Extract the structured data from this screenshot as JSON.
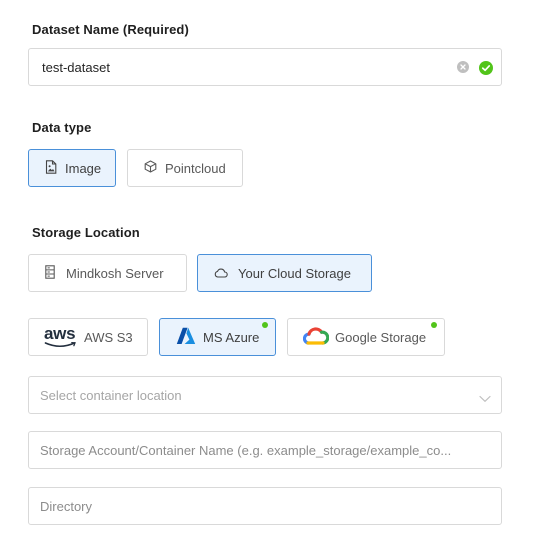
{
  "dataset_name": {
    "label": "Dataset Name (Required)",
    "value": "test-dataset",
    "icons": [
      "clear-icon",
      "valid-check-icon"
    ]
  },
  "data_type": {
    "label": "Data type",
    "options": [
      {
        "label": "Image",
        "icon": "image-file-icon",
        "selected": true
      },
      {
        "label": "Pointcloud",
        "icon": "cube-icon",
        "selected": false
      }
    ]
  },
  "storage_location": {
    "label": "Storage Location",
    "options": [
      {
        "label": "Mindkosh Server",
        "icon": "server-icon",
        "selected": false
      },
      {
        "label": "Your Cloud Storage",
        "icon": "cloud-icon",
        "selected": true
      }
    ]
  },
  "providers": [
    {
      "logo_text": "aws",
      "label": "AWS S3",
      "icon": "aws-logo-icon",
      "selected": false,
      "connected": false
    },
    {
      "label": "MS Azure",
      "icon": "azure-logo-icon",
      "selected": true,
      "connected": true
    },
    {
      "label": "Google Storage",
      "icon": "google-cloud-logo-icon",
      "selected": false,
      "connected": true
    }
  ],
  "container_select": {
    "placeholder": "Select container location"
  },
  "account_input": {
    "placeholder": "Storage Account/Container Name (e.g. example_storage/example_co..."
  },
  "directory_input": {
    "placeholder": "Directory"
  },
  "colors": {
    "accent": "#4a90d9",
    "selected_bg": "#eaf3fd",
    "success": "#52c41a",
    "border": "#d9d9d9"
  }
}
